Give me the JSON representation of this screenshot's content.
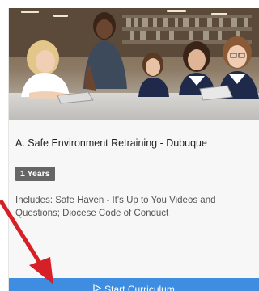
{
  "card": {
    "image_alt": "Teacher with students using tablets in a library",
    "title": "A. Safe Environment Retraining - Dubuque",
    "duration_badge": "1 Years",
    "description": "Includes: Safe Haven - It's Up to You Videos and Questions; Diocese Code of Conduct",
    "start_button_label": "Start Curriculum",
    "start_button_icon": "play-outline-icon"
  },
  "colors": {
    "button_bg": "#3f8de0",
    "badge_bg": "#666666",
    "arrow": "#d71f26"
  }
}
